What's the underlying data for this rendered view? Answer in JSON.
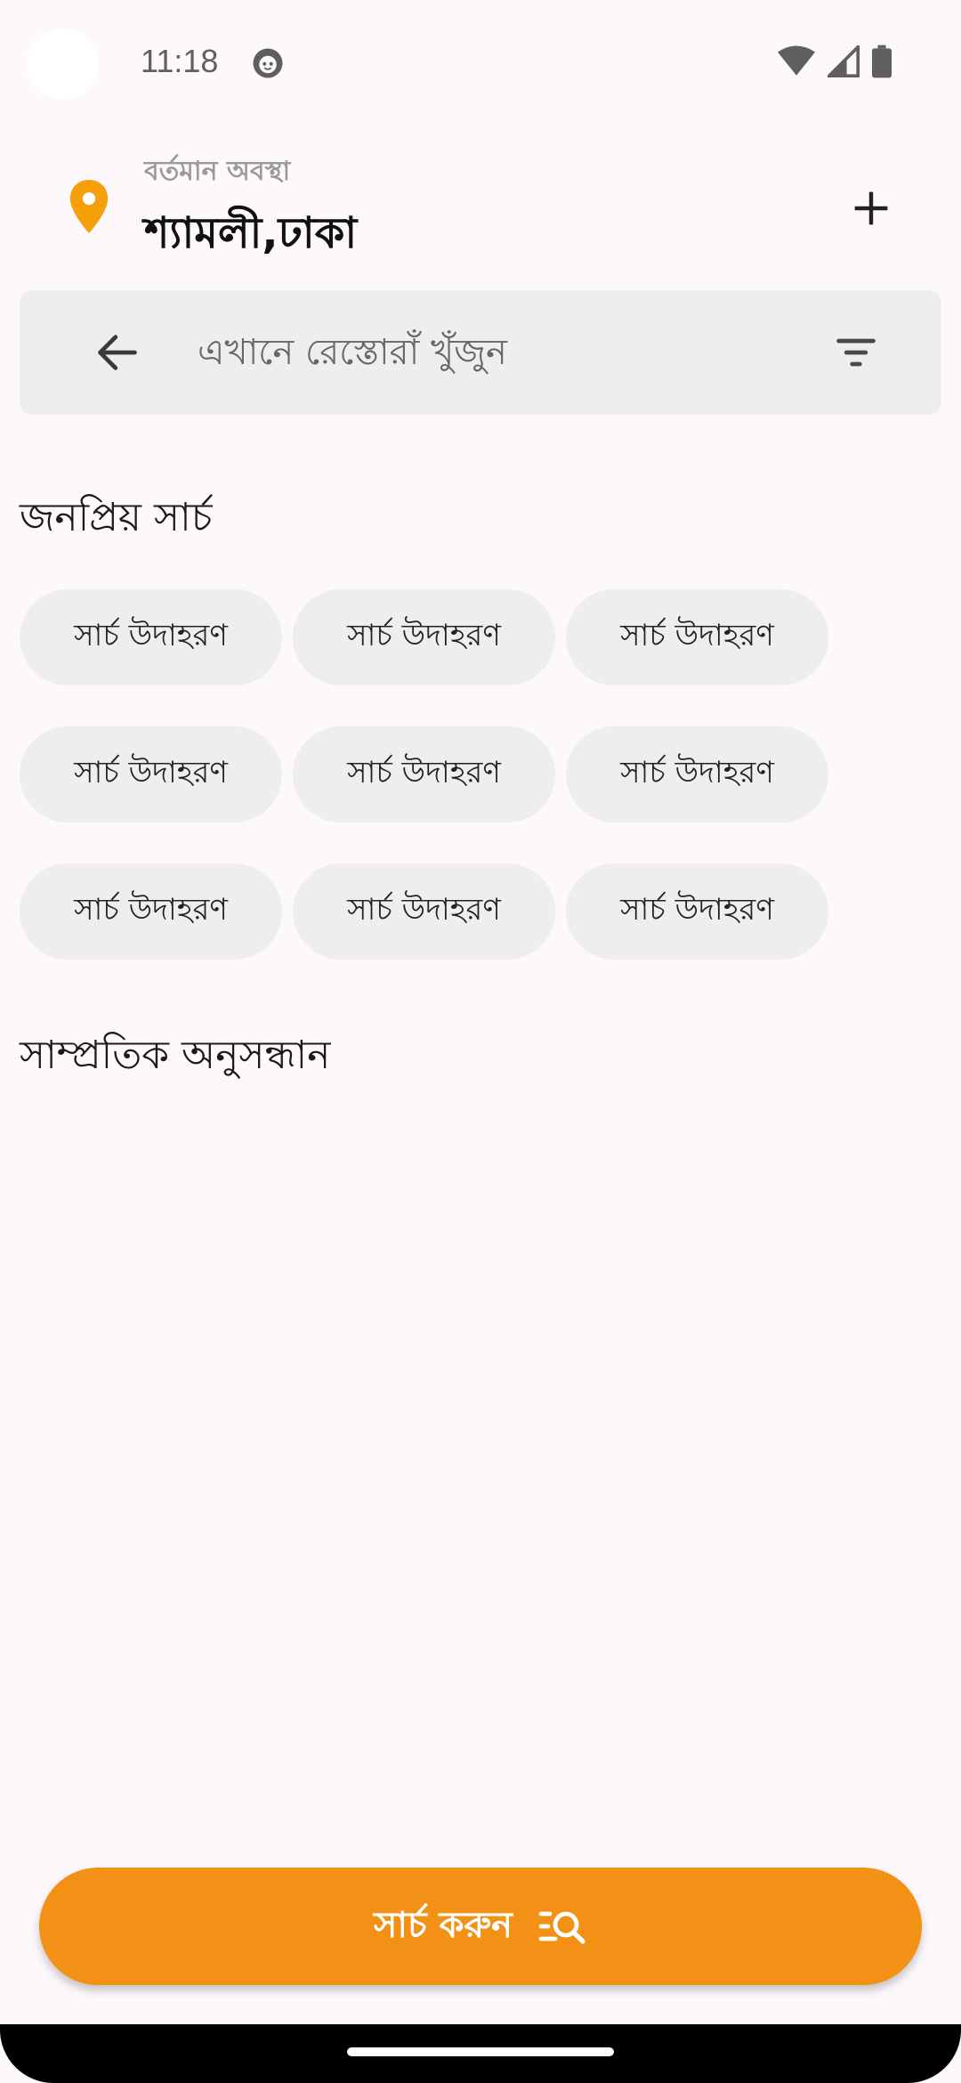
{
  "status_bar": {
    "time": "11:18"
  },
  "location": {
    "label": "বর্তমান অবস্থা",
    "value": "শ্যামলী,ঢাকা"
  },
  "search": {
    "placeholder": "এখানে রেস্তোরাঁ খুঁজুন"
  },
  "popular": {
    "title": "জনপ্রিয় সার্চ",
    "chips": [
      "সার্চ উদাহরণ",
      "সার্চ উদাহরণ",
      "সার্চ উদাহরণ",
      "সার্চ উদাহরণ",
      "সার্চ উদাহরণ",
      "সার্চ উদাহরণ",
      "সার্চ উদাহরণ",
      "সার্চ উদাহরণ",
      "সার্চ উদাহরণ"
    ]
  },
  "recent": {
    "title": "সাম্প্রতিক অনুসন্ধান"
  },
  "cta": {
    "label": "সার্চ করুন"
  },
  "colors": {
    "accent": "#f29115",
    "pin": "#f5a00a",
    "chip_bg": "#eeeeee",
    "background": "#fdf8fb"
  },
  "icons": [
    "notification-face-icon",
    "wifi-icon",
    "signal-icon",
    "battery-icon",
    "location-pin-icon",
    "plus-icon",
    "back-arrow-icon",
    "filter-icon",
    "list-search-icon"
  ]
}
